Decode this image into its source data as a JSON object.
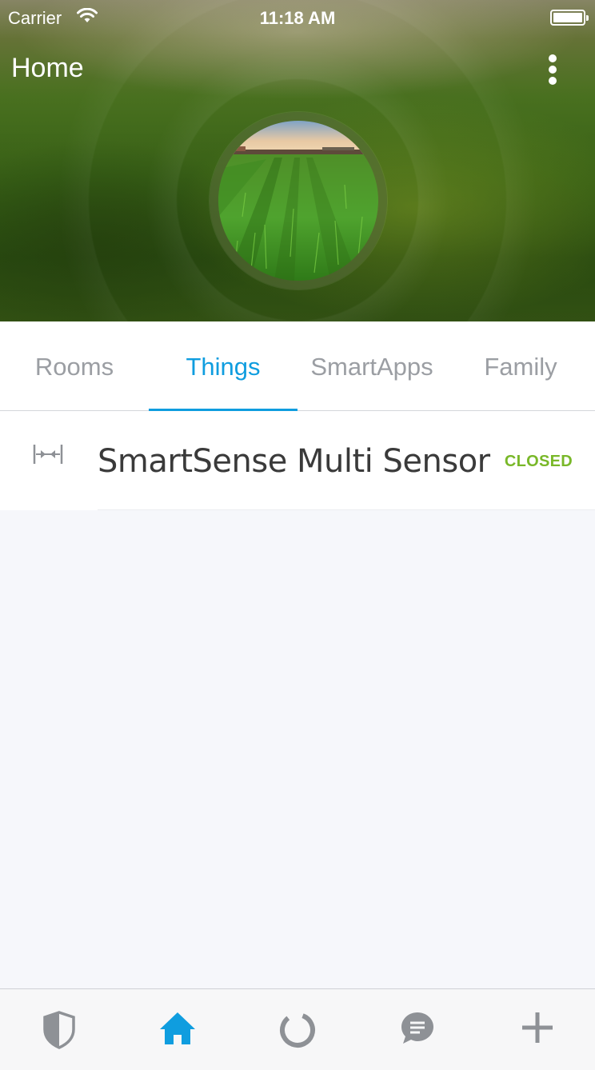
{
  "status_bar": {
    "carrier": "Carrier",
    "time": "11:18 AM"
  },
  "header": {
    "title": "Home",
    "menu_icon": "more-vertical-icon",
    "avatar_image": "wheat-field-photo"
  },
  "tabs": [
    {
      "label": "Rooms",
      "active": false
    },
    {
      "label": "Things",
      "active": true
    },
    {
      "label": "SmartApps",
      "active": false
    },
    {
      "label": "Family",
      "active": false
    }
  ],
  "devices": [
    {
      "name": "SmartSense Multi Sensor",
      "status": "CLOSED",
      "icon": "contact-sensor-icon"
    }
  ],
  "bottom_tabs": [
    {
      "icon": "shield-icon",
      "active": false
    },
    {
      "icon": "home-icon",
      "active": true
    },
    {
      "icon": "activity-ring-icon",
      "active": false
    },
    {
      "icon": "chat-icon",
      "active": false
    },
    {
      "icon": "plus-icon",
      "active": false
    }
  ],
  "colors": {
    "accent": "#0f9ddf",
    "status_closed": "#79b829",
    "tab_inactive": "#9b9ea3",
    "background": "#f6f7fb"
  }
}
